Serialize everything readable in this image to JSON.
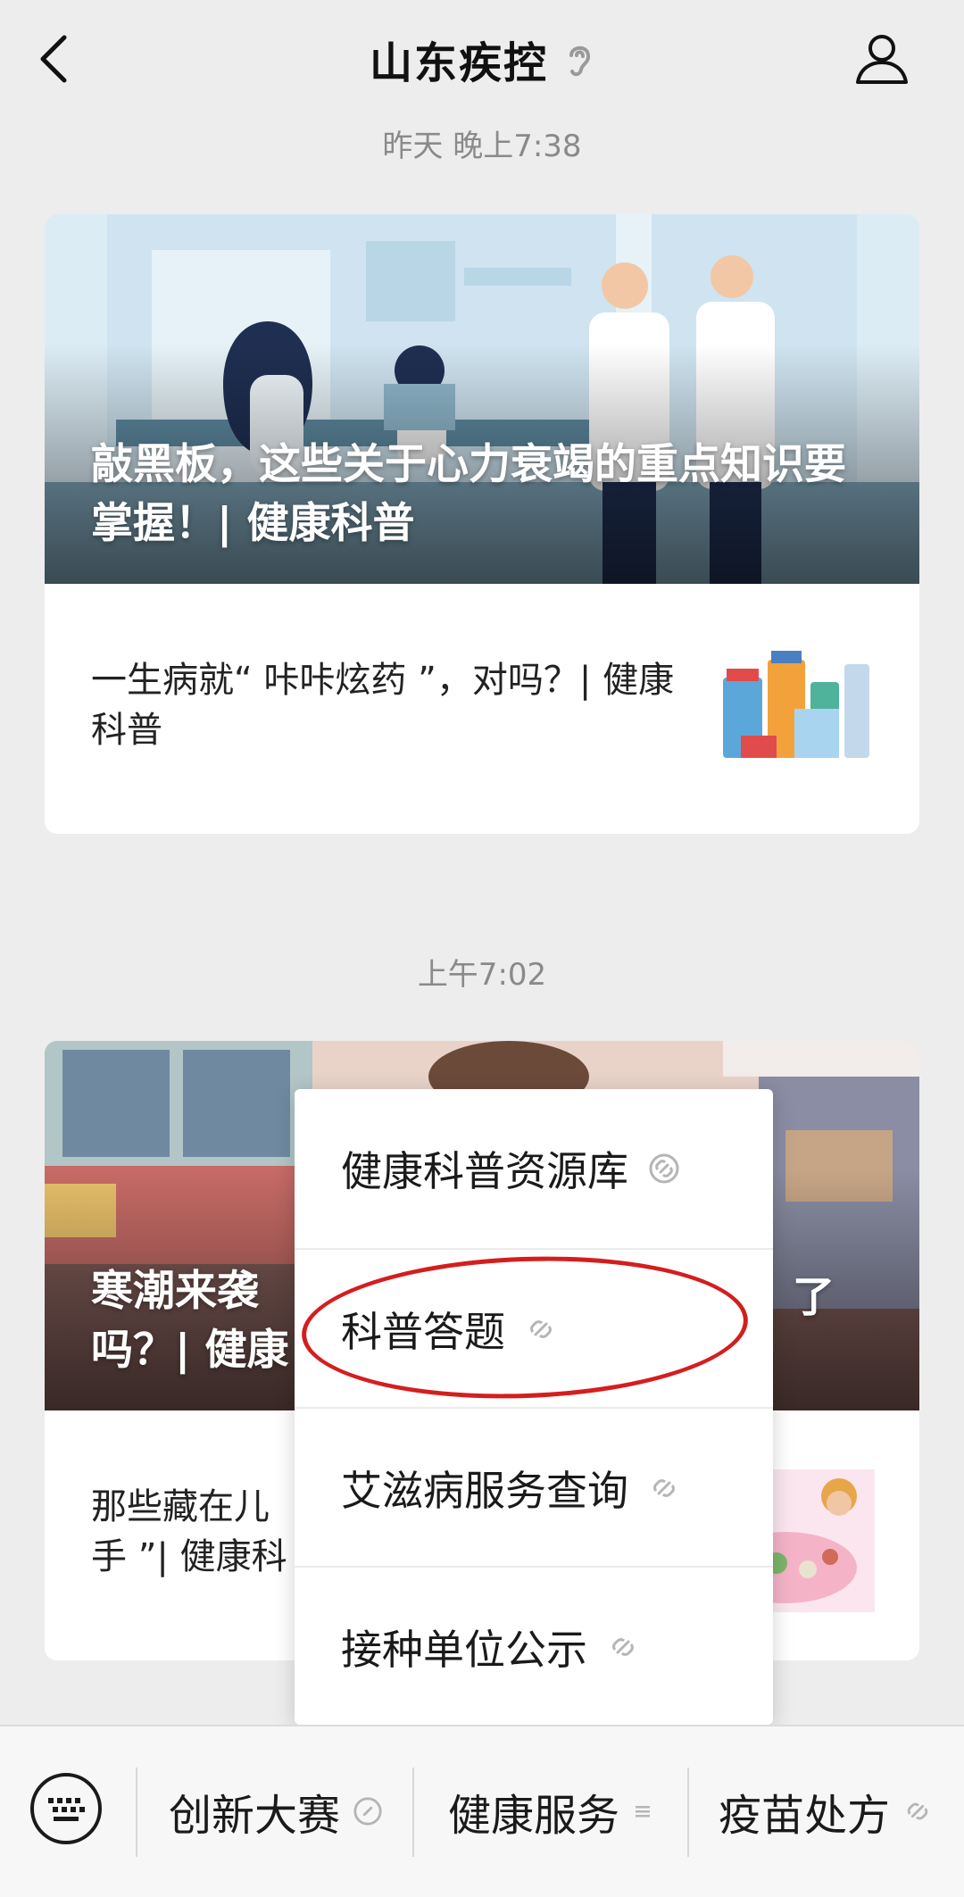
{
  "header": {
    "title": "山东疾控",
    "back_icon": "chevron-left-icon",
    "listen_icon": "ear-icon",
    "profile_icon": "person-icon"
  },
  "messages": [
    {
      "timestamp": "昨天 晚上7:38",
      "cover_title": "敲黑板，这些关于心力衰竭的重点知识要掌握！| 健康科普",
      "sub_title": "一生病就“ 咔咔炫药 ”，对吗？| 健康科普"
    },
    {
      "timestamp": "上午7:02",
      "cover_title_left": "寒潮来袭",
      "cover_title_left_line2": "吗？| 健康",
      "cover_title_right": "了",
      "sub_title_line1": "那些藏在儿",
      "sub_title_line2": "手 ”| 健康科"
    }
  ],
  "popup_menu": {
    "items": [
      {
        "label": "健康科普资源库",
        "icon": "link-icon"
      },
      {
        "label": "科普答题",
        "icon": "link-icon"
      },
      {
        "label": "艾滋病服务查询",
        "icon": "link-icon"
      },
      {
        "label": "接种单位公示",
        "icon": "link-icon"
      }
    ],
    "highlighted_index": 1,
    "highlight_color": "#d41e1e"
  },
  "bottom_bar": {
    "keyboard_icon": "keyboard-icon",
    "items": [
      {
        "label": "创新大赛",
        "icon": "link-icon"
      },
      {
        "label": "健康服务",
        "icon": "menu-lines-icon"
      },
      {
        "label": "疫苗处方",
        "icon": "link-icon"
      }
    ]
  }
}
